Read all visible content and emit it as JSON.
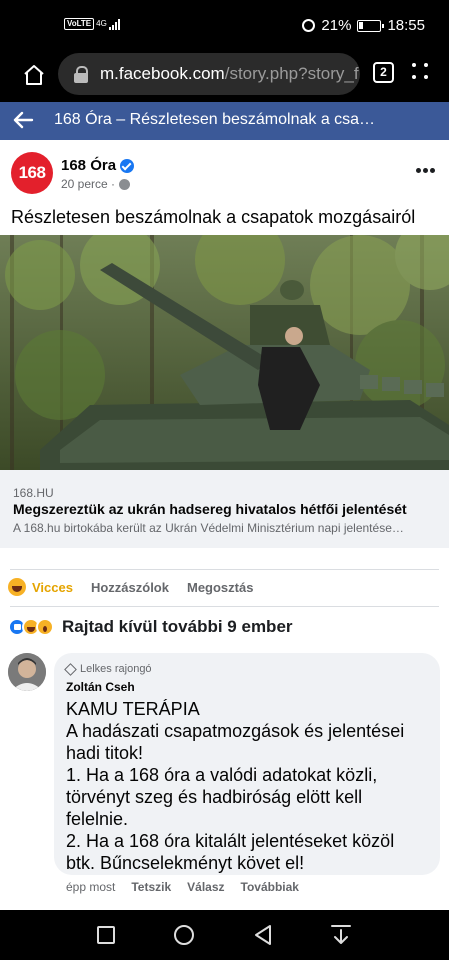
{
  "status_bar": {
    "volte": "VoLTE",
    "network": "4G",
    "battery": "21%",
    "battery_level": 0.21,
    "time": "18:55"
  },
  "browser": {
    "url_host": "m.facebook.com",
    "url_path": "/story.php?story_f",
    "tab_count": "2"
  },
  "fb_header": {
    "title": "168 Óra – Részletesen beszámolnak a csa…"
  },
  "post": {
    "avatar_text": "168",
    "page_name": "168 Óra",
    "time": "20 perce ·",
    "text": "Részletesen beszámolnak a csapatok mozgásairól",
    "link": {
      "domain": "168.HU",
      "title": "Megszereztük az ukrán hadsereg hivatalos hétfői jelentését",
      "description": "A 168.hu birtokába került az Ukrán Védelmi Minisztérium napi jelentése…"
    },
    "actions": {
      "reaction": "Vicces",
      "comment": "Hozzászólok",
      "share": "Megosztás"
    },
    "reactions_summary": "Rajtad kívül további 9 ember"
  },
  "comment": {
    "badge": "Lelkes rajongó",
    "author": "Zoltán Cseh",
    "lines": [
      "KAMU TERÁPIA",
      "A hadászati csapatmozgások és jelentései",
      "hadi titok!",
      "1. Ha a 168 óra a valódi adatokat közli,",
      "törvényt szeg és hadbiróság elött kell",
      "felelnie.",
      "2. Ha a 168 óra kitalált jelentéseket közöl",
      "btk. Bűncselekményt követ el!"
    ],
    "time": "épp most",
    "like": "Tetszik",
    "reply": "Válasz",
    "more": "Továbbiak"
  }
}
